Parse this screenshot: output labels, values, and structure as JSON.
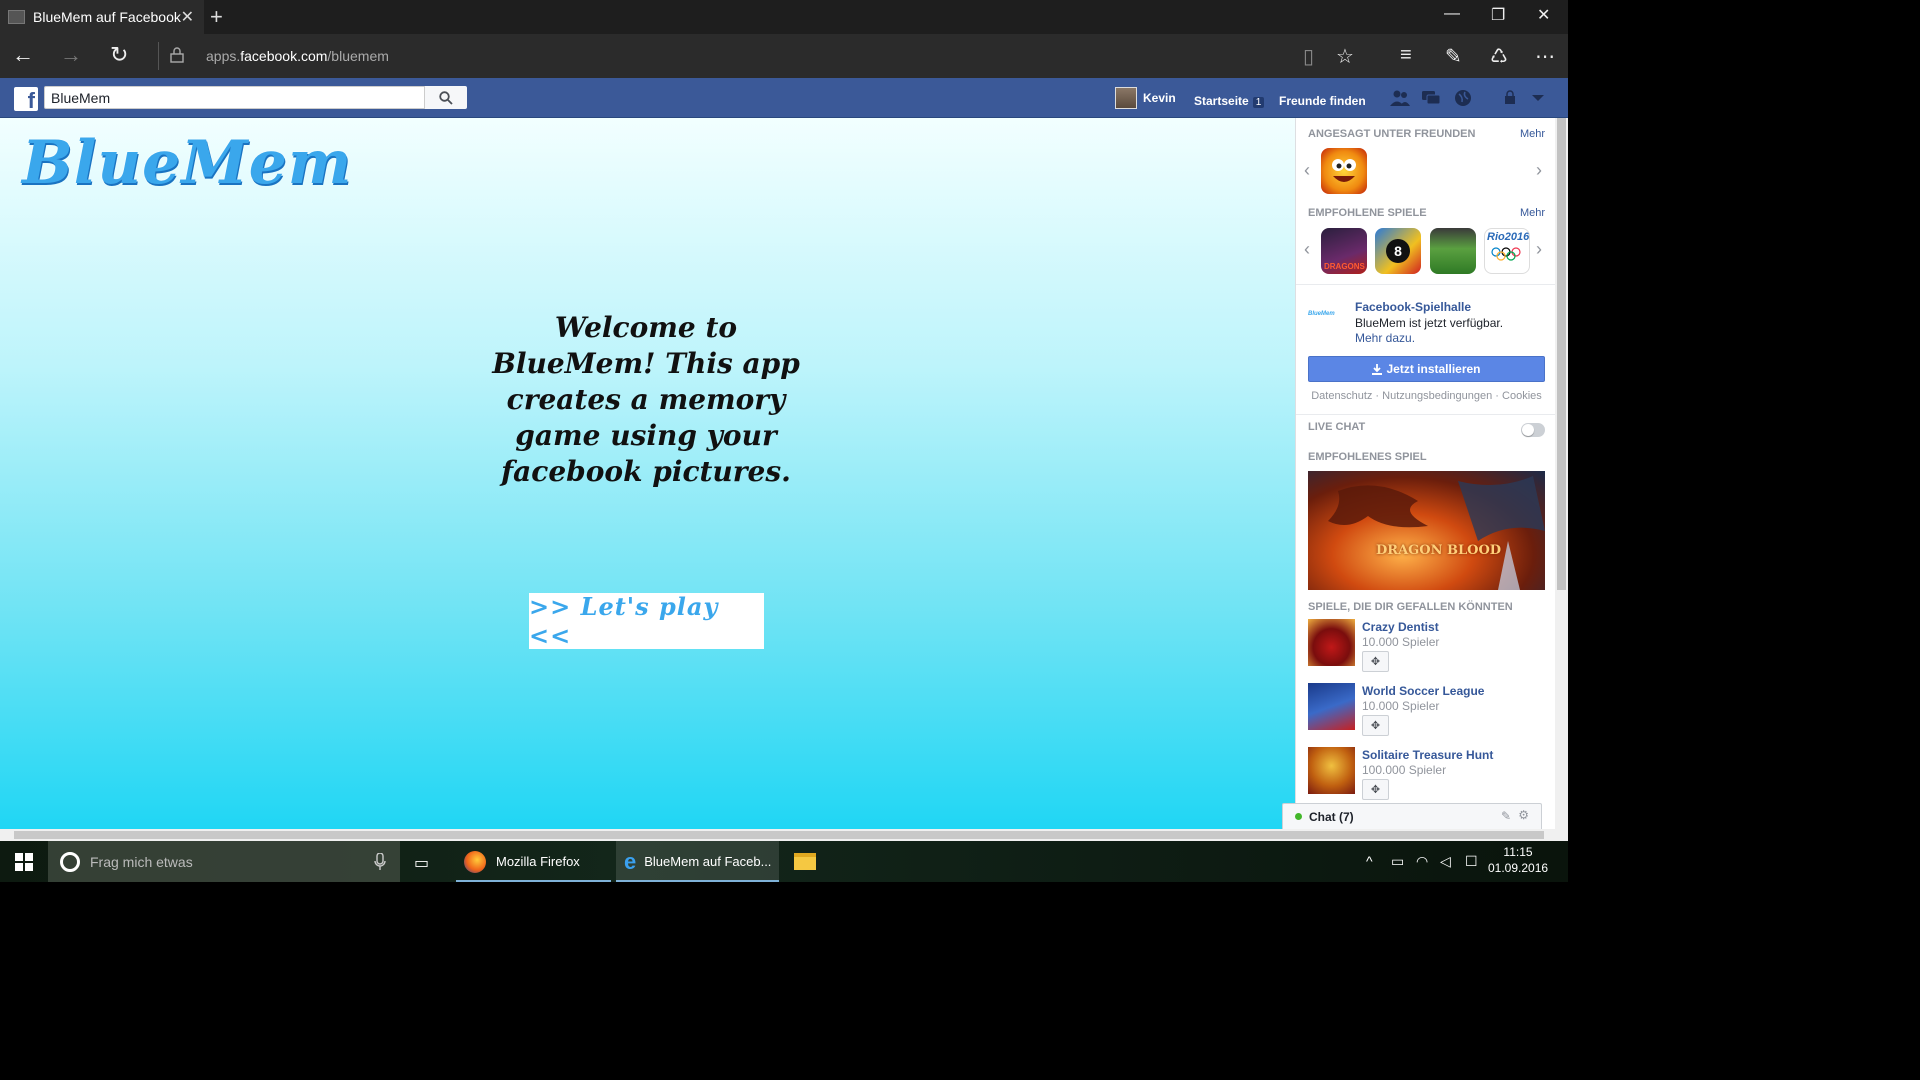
{
  "browser": {
    "tab_title": "BlueMem auf Facebook",
    "url_prefix": "apps.",
    "url_domain": "facebook.com",
    "url_path": "/bluemem"
  },
  "fb": {
    "search_value": "BlueMem",
    "user_name": "Kevin",
    "home_label": "Startseite",
    "home_badge": "1",
    "find_friends": "Freunde finden",
    "brand_color": "#3b5998"
  },
  "app": {
    "logo_text": "BlueMem",
    "welcome_text": "Welcome to BlueMem! This app creates a memory game using your facebook pictures.",
    "play_button": ">> Let's play <<"
  },
  "sidebar": {
    "trending_heading": "ANGESAGT UNTER FREUNDEN",
    "trending_more": "Mehr",
    "recommended_heading": "EMPFOHLENE SPIELE",
    "recommended_more": "Mehr",
    "recommended_tiles": [
      {
        "name": "dragons-game-icon",
        "label": "DRAGONS"
      },
      {
        "name": "8-ball-pool-icon",
        "label": "8"
      },
      {
        "name": "soccer-game-icon",
        "label": ""
      },
      {
        "name": "rio2016-icon",
        "label": "Rio2016"
      }
    ],
    "arcade_title": "Facebook-Spielhalle",
    "arcade_sub": "BlueMem ist jetzt verfügbar.",
    "arcade_link": "Mehr dazu.",
    "install_button": "Jetzt installieren",
    "legal": "Datenschutz · Nutzungsbedingungen · Cookies",
    "live_chat": "LIVE CHAT",
    "featured_heading": "EMPFOHLENES SPIEL",
    "featured_game": "DRAGON BLOOD",
    "suggested_heading": "SPIELE, DIE DIR GEFALLEN KÖNNTEN",
    "suggested": [
      {
        "name": "Crazy Dentist",
        "count": "10.000 Spieler"
      },
      {
        "name": "World Soccer League",
        "count": "10.000 Spieler"
      },
      {
        "name": "Solitaire Treasure Hunt",
        "count": "100.000 Spieler"
      }
    ],
    "chat_label": "Chat (7)"
  },
  "taskbar": {
    "search_placeholder": "Frag mich etwas",
    "apps": [
      {
        "label": "Mozilla Firefox"
      },
      {
        "label": "BlueMem auf Faceb..."
      }
    ],
    "time": "11:15",
    "date": "01.09.2016"
  }
}
